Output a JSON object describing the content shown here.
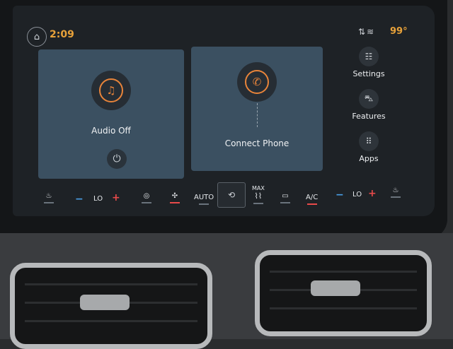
{
  "status_bar": {
    "time": "2:09",
    "temperature": "99°",
    "icons": [
      "home-icon",
      "signal-icon",
      "wifi-icon"
    ]
  },
  "cards": {
    "audio": {
      "label": "Audio Off",
      "icon": "music-note-icon",
      "power_icon": "power-icon"
    },
    "phone": {
      "label": "Connect Phone",
      "icon": "phone-icon"
    }
  },
  "side_menu": [
    {
      "label": "Settings",
      "icon": "sliders-icon"
    },
    {
      "label": "Features",
      "icon": "car-icon"
    },
    {
      "label": "Apps",
      "icon": "grid-icon"
    }
  ],
  "climate": {
    "left_temp": "LO",
    "right_temp": "LO",
    "auto_label": "AUTO",
    "max_label": "MAX",
    "ac_label": "A/C",
    "minus": "−",
    "plus": "+"
  },
  "colors": {
    "accent": "#e8a23a",
    "card": "#3b5061",
    "minus": "#4aa0e8",
    "plus": "#e84a4a"
  }
}
